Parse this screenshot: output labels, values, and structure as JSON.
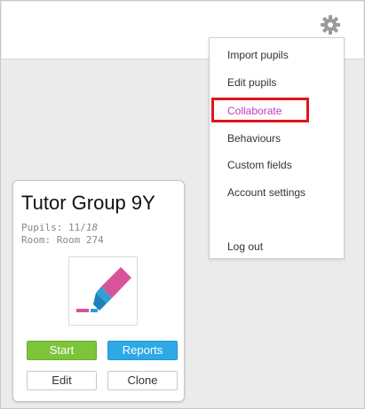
{
  "menu": {
    "items": [
      {
        "label": "Import pupils"
      },
      {
        "label": "Edit pupils"
      },
      {
        "label": "Collaborate"
      },
      {
        "label": "Behaviours"
      },
      {
        "label": "Custom fields"
      },
      {
        "label": "Account settings"
      },
      {
        "label": "Log out"
      }
    ],
    "active_color": "#c03ac0",
    "highlight_color": "#e0151b"
  },
  "card": {
    "title": "Tutor Group 9Y",
    "pupils_label": "Pupils: 11/",
    "pupils_total": "18",
    "room_label": "Room: Room 274",
    "logo": "highlighter-icon",
    "buttons": {
      "start": "Start",
      "reports": "Reports",
      "edit": "Edit",
      "clone": "Clone"
    }
  },
  "colors": {
    "start": "#7cc43a",
    "reports": "#2fa9e6"
  }
}
